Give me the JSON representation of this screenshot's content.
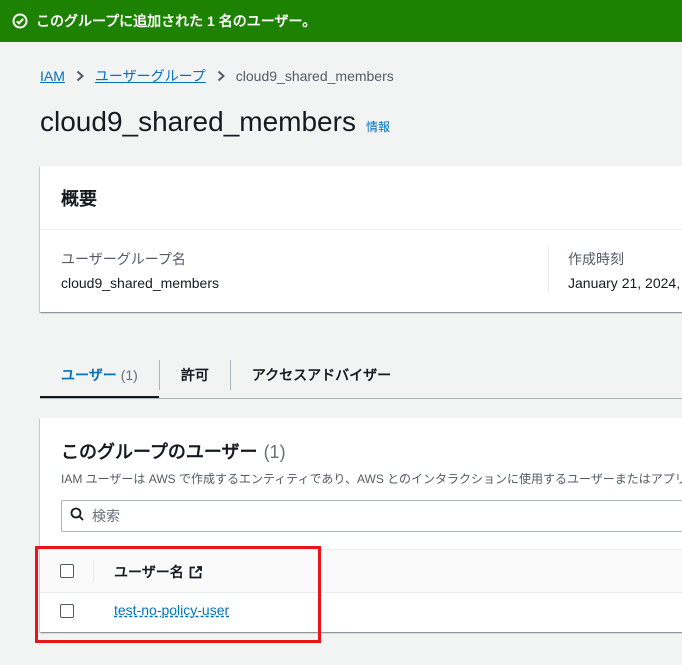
{
  "flash": {
    "message": "このグループに追加された 1 名のユーザー。",
    "icon": "check-circle-icon",
    "color": "#1d8102"
  },
  "breadcrumb": {
    "items": [
      "IAM",
      "ユーザーグループ"
    ],
    "current": "cloud9_shared_members"
  },
  "page": {
    "title": "cloud9_shared_members",
    "info_link": "情報"
  },
  "summary": {
    "heading": "概要",
    "group_name_label": "ユーザーグループ名",
    "group_name_value": "cloud9_shared_members",
    "created_label": "作成時刻",
    "created_value": "January 21, 2024,"
  },
  "tabs": [
    {
      "label": "ユーザー",
      "count": "(1)",
      "active": true
    },
    {
      "label": "許可"
    },
    {
      "label": "アクセスアドバイザー"
    }
  ],
  "users_panel": {
    "heading": "このグループのユーザー",
    "count": "(1)",
    "description": "IAM ユーザーは AWS で作成するエンティティであり、AWS とのインタラクションに使用するユーザーまたはアプリ",
    "search_placeholder": "検索",
    "column_header": "ユーザー名",
    "rows": [
      {
        "username": "test-no-policy-user"
      }
    ]
  },
  "colors": {
    "link": "#0073bb",
    "highlight_box": "#e8141c"
  }
}
